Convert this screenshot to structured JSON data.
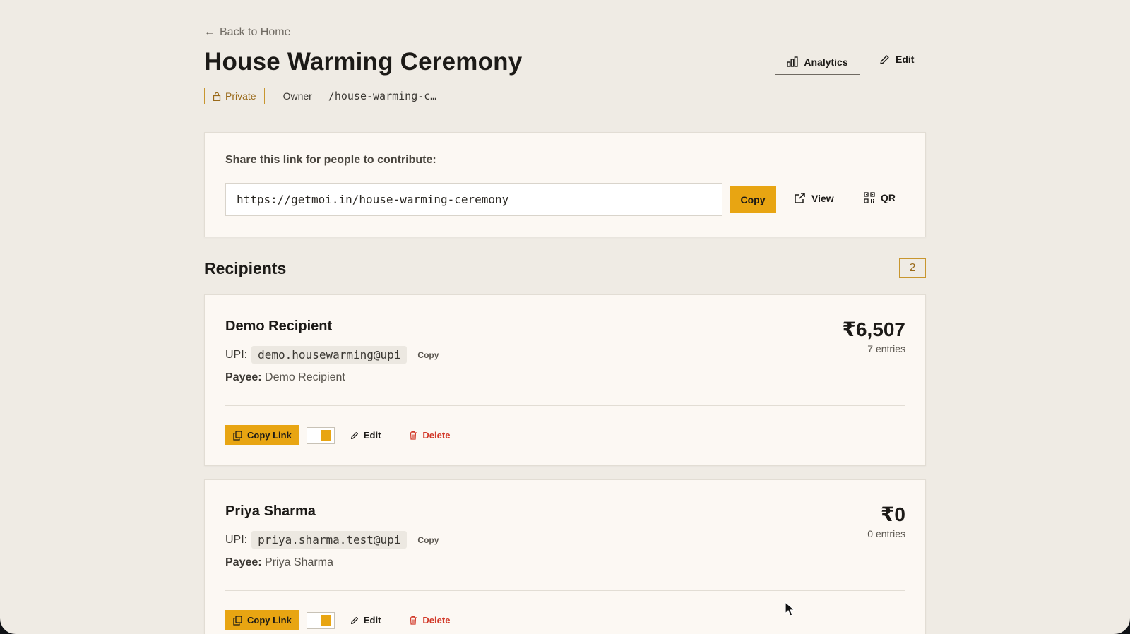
{
  "header": {
    "back_label": "Back to Home",
    "title": "House Warming Ceremony",
    "visibility_badge": "Private",
    "role": "Owner",
    "slug": "/house-warming-c…",
    "analytics_label": "Analytics",
    "edit_label": "Edit"
  },
  "share": {
    "label": "Share this link for people to contribute:",
    "url": "https://getmoi.in/house-warming-ceremony",
    "copy_label": "Copy",
    "view_label": "View",
    "qr_label": "QR"
  },
  "recipients": {
    "title": "Recipients",
    "count": "2",
    "items": [
      {
        "name": "Demo Recipient",
        "upi_label": "UPI:",
        "upi": "demo.housewarming@upi",
        "upi_copy_label": "Copy",
        "payee_label": "Payee:",
        "payee": "Demo Recipient",
        "amount": "₹6,507",
        "entries": "7 entries",
        "copy_link_label": "Copy Link",
        "toggle_on": true,
        "edit_label": "Edit",
        "delete_label": "Delete"
      },
      {
        "name": "Priya Sharma",
        "upi_label": "UPI:",
        "upi": "priya.sharma.test@upi",
        "upi_copy_label": "Copy",
        "payee_label": "Payee:",
        "payee": "Priya Sharma",
        "amount": "₹0",
        "entries": "0 entries",
        "copy_link_label": "Copy Link",
        "toggle_on": true,
        "edit_label": "Edit",
        "delete_label": "Delete"
      }
    ]
  },
  "colors": {
    "accent": "#e8a512",
    "background": "#efebe4",
    "card": "#fcf8f3",
    "danger": "#d23a2a",
    "badge_border": "#c8962f"
  },
  "icons": {
    "back": "arrow-left-icon",
    "private": "lock-icon",
    "analytics": "bar-chart-icon",
    "edit": "pencil-icon",
    "view": "external-link-icon",
    "qr": "qr-code-icon",
    "copy_link": "copy-icon",
    "delete": "trash-icon"
  }
}
